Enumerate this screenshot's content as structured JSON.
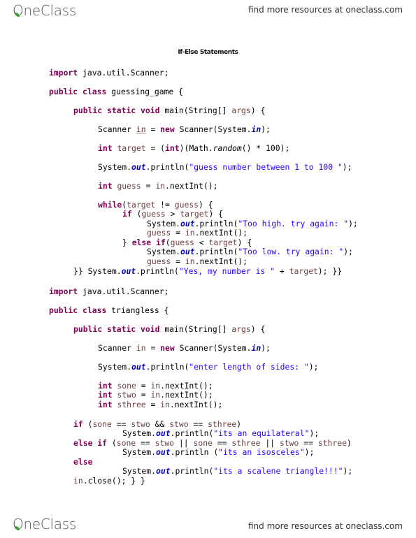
{
  "header": {
    "logo_text": "OneClass",
    "tagline": "find more resources at oneclass.com"
  },
  "document": {
    "title": "If-Else Statements"
  },
  "footer": {
    "logo_text": "OneClass",
    "tagline": "find more resources at oneclass.com"
  },
  "colors": {
    "keyword": "#7f0055",
    "string": "#2a00ff",
    "static_field": "#0000c0",
    "local_variable": "#6a3e3e",
    "logo_leaf": "#3f9a3a"
  },
  "code": {
    "program1": [
      "import java.util.Scanner;",
      "public class guessing_game {",
      "public static void main(String[] args) {",
      "Scanner in = new Scanner(System.in);",
      "int target = (int)(Math.random() * 100);",
      "System.out.println(\"guess number between 1 to 100 \");",
      "int guess = in.nextInt();",
      "while(target != guess) {",
      "if (guess > target) {",
      "System.out.println(\"Too high. try again: \");",
      "guess = in.nextInt();",
      "} else if(guess < target) {",
      "System.out.println(\"Too low. try again: \");",
      "guess = in.nextInt();",
      "}} System.out.println(\"Yes, my number is \" + target); }}"
    ],
    "program2": [
      "import java.util.Scanner;",
      "public class triangless {",
      "public static void main(String[] args) {",
      "Scanner in = new Scanner(System.in);",
      "System.out.println(\"enter length of sides: \");",
      "int sone = in.nextInt();",
      "int stwo = in.nextInt();",
      "int sthree = in.nextInt();",
      "if (sone == stwo && stwo == sthree)",
      "System.out.println(\"its an equilateral\");",
      "else if (sone == stwo || sone == sthree || stwo == sthree)",
      "System.out.println (\"its an isosceles\");",
      "else",
      "System.out.println(\"its a scalene triangle!!!\");",
      "in.close(); } }"
    ],
    "tokens": {
      "import": "import",
      "package": " java.util.Scanner;",
      "public": "public",
      "class": "class",
      "static": "static",
      "void": "void",
      "new": "new",
      "int": "int",
      "while": "while",
      "if": "if",
      "else": "else",
      "class1_name": " guessing_game {",
      "class2_name": " triangless {",
      "main_sig_a": " main(String[] ",
      "args": "args",
      "main_sig_b": ") {",
      "scanner_decl": "Scanner ",
      "in_var": "in",
      "eq": " = ",
      "scanner_ctor_a": " Scanner(System.",
      "in_field": "in",
      "close_paren_semi": ");",
      "target": "target",
      "guess": "guess",
      "cast_a": " = (",
      "cast_b": ")(Math.",
      "random": "random",
      "times100": "() * 100);",
      "system_dot": "System.",
      "out": "out",
      "println_open": ".println(",
      "println_open_space": ".println (",
      "s_guess_range": "\"guess number between 1 to 100 \"",
      "s_too_high": "\"Too high. try again: \"",
      "s_too_low": "\"Too low. try again: \"",
      "s_yes": "\"Yes, my number is \"",
      "s_enter": "\"enter length of sides: \"",
      "s_equi": "\"its an equilateral\"",
      "s_iso": "\"its an isosceles\"",
      "s_scal": "\"its a scalene triangle!!!\"",
      "next_int": ".nextInt();",
      "while_a": "(",
      "neq": " != ",
      "while_b": ") {",
      "if_open": " (",
      "gt": " > ",
      "lt": " < ",
      "brace_else": "} ",
      "else_if_open": "(",
      "close_brace_open": ") {",
      "end1_a": "}} ",
      "plus": " + ",
      "end1_b": "); }}",
      "sone": "sone",
      "stwo": "stwo",
      "sthree": "sthree",
      "eqeq": " == ",
      "and": " && ",
      "or": " || ",
      "close_paren": ")",
      "close_stmt": ".close(); } }"
    }
  }
}
